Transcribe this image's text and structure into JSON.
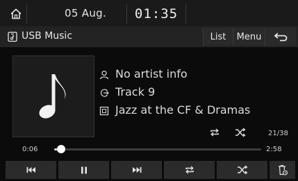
{
  "status_bar": {
    "date": "05 Aug.",
    "time": "01:35"
  },
  "header": {
    "source_title": "USB Music",
    "list_label": "List",
    "menu_label": "Menu"
  },
  "track_info": {
    "artist": "No artist info",
    "track": "Track  9",
    "album": "Jazz at the CF & Dramas"
  },
  "playback": {
    "track_counter": "21/38",
    "elapsed": "0:06",
    "total": "2:58",
    "progress_fraction": 0.034
  },
  "icons": {
    "home": "home-icon",
    "usb": "usb-music-icon",
    "back": "back-arrow-icon",
    "album_art": "music-note-icon",
    "artist": "person-icon",
    "track": "track-icon",
    "album": "album-icon",
    "repeat": "repeat-icon",
    "shuffle": "shuffle-icon",
    "prev": "skip-previous-icon",
    "pause": "pause-icon",
    "next": "skip-next-icon",
    "delete": "trash-icon"
  },
  "colors": {
    "background": "#0b0b0b",
    "bar": "#2b2b2b",
    "text": "#e6e6e6",
    "progress": "#d8d8d8"
  }
}
